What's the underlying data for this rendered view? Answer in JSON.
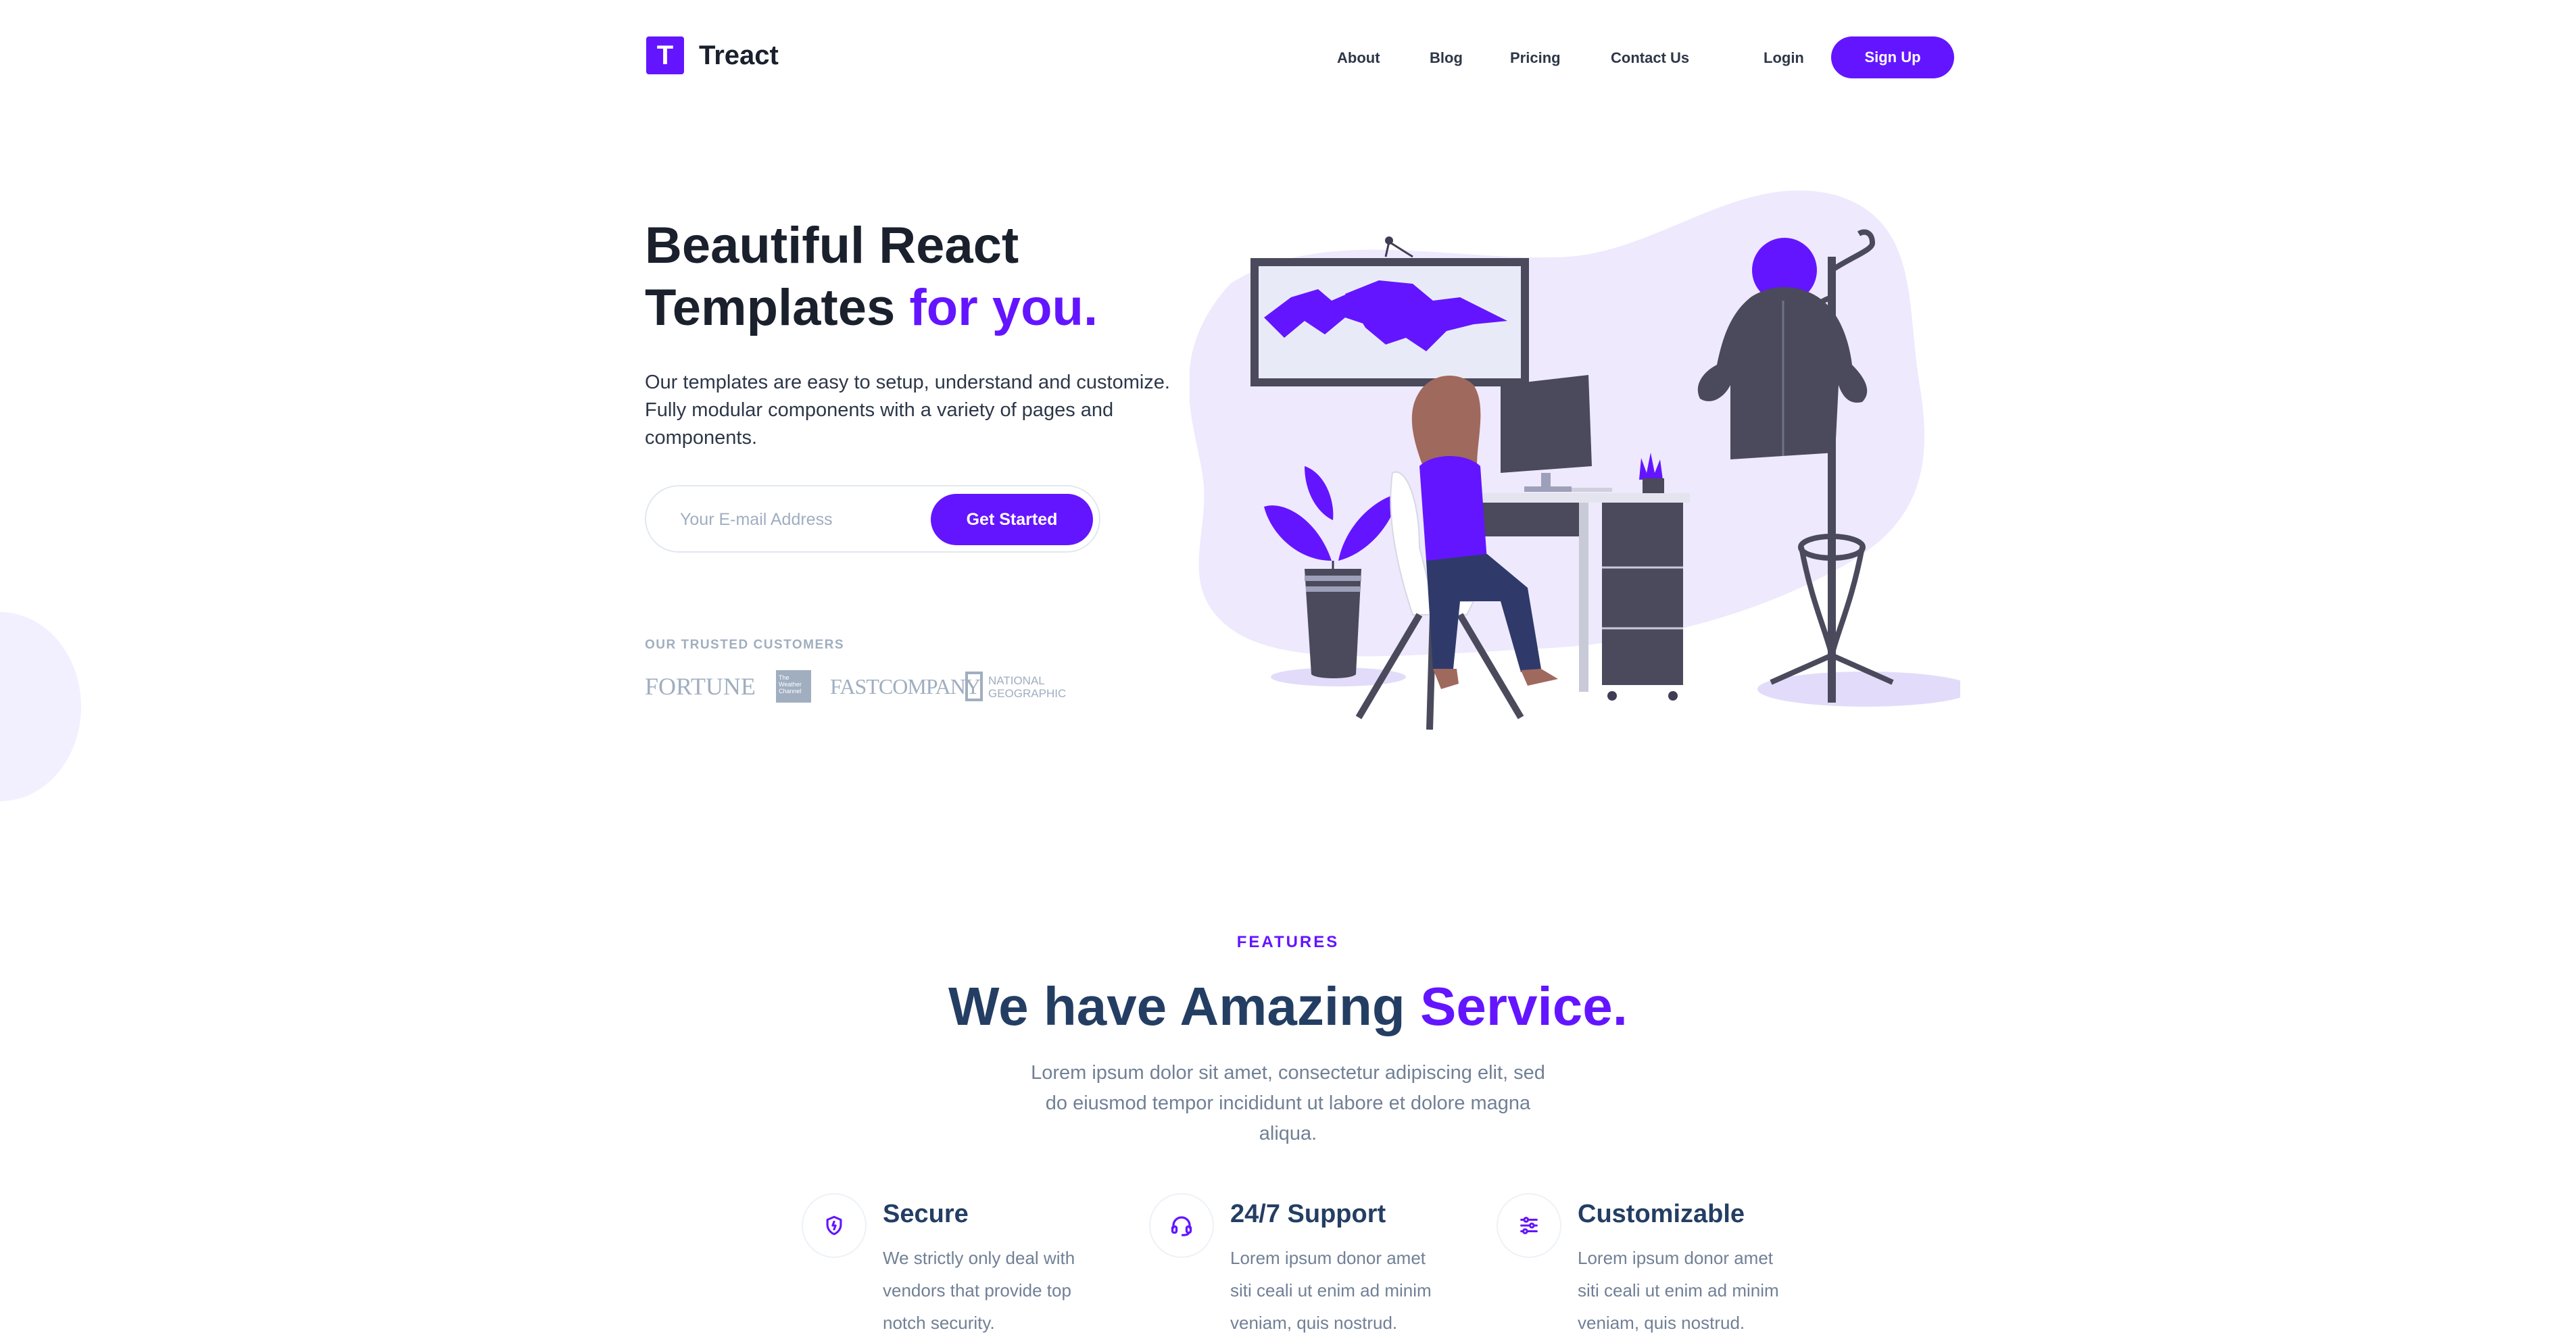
{
  "brand": {
    "logo_letter": "T",
    "name": "Treact"
  },
  "nav": {
    "links": [
      "About",
      "Blog",
      "Pricing",
      "Contact Us"
    ],
    "login": "Login",
    "signup": "Sign Up"
  },
  "hero": {
    "title_line1": "Beautiful React",
    "title_line2_plain": "Templates ",
    "title_line2_accent": "for you.",
    "description": "Our templates are easy to setup, understand and customize. Fully modular components with a variety of pages and components.",
    "email_placeholder": "Your E-mail Address",
    "cta": "Get Started",
    "trusted_label": "OUR TRUSTED CUSTOMERS",
    "customers": [
      "FORTUNE",
      "The Weather Channel",
      "FASTCOMPANY",
      "NATIONAL GEOGRAPHIC"
    ]
  },
  "features": {
    "kicker": "FEATURES",
    "heading_plain": "We have Amazing ",
    "heading_accent": "Service.",
    "description": "Lorem ipsum dolor sit amet, consectetur adipiscing elit, sed do eiusmod tempor incididunt ut labore et dolore magna aliqua.",
    "cards": [
      {
        "icon": "shield-icon",
        "title": "Secure",
        "text": "We strictly only deal with vendors that provide top notch security."
      },
      {
        "icon": "headset-icon",
        "title": "24/7 Support",
        "text": "Lorem ipsum donor amet siti ceali ut enim ad minim veniam, quis nostrud."
      },
      {
        "icon": "sliders-icon",
        "title": "Customizable",
        "text": "Lorem ipsum donor amet siti ceali ut enim ad minim veniam, quis nostrud."
      }
    ]
  },
  "colors": {
    "primary": "#6415ff",
    "heading": "#243e63",
    "text_muted": "#718096",
    "blob": "#f2efff"
  }
}
